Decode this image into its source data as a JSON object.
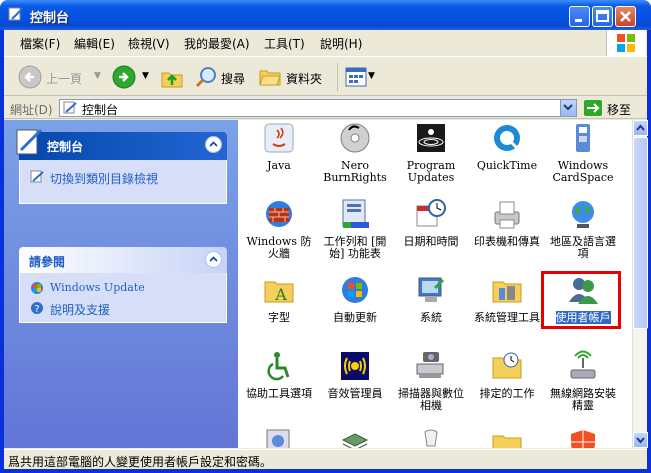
{
  "window": {
    "title": "控制台"
  },
  "menu": [
    "檔案(F)",
    "編輯(E)",
    "檢視(V)",
    "我的最愛(A)",
    "工具(T)",
    "說明(H)"
  ],
  "toolbar": {
    "back": "上一頁",
    "search": "搜尋",
    "folders": "資料夾"
  },
  "address": {
    "label": "網址(D)",
    "value": "控制台",
    "go": "移至"
  },
  "sidebar": {
    "panel1": {
      "title": "控制台",
      "link": "切換到類別目錄檢視"
    },
    "panel2": {
      "title": "請參閱",
      "links": [
        "Windows Update",
        "說明及支援"
      ]
    }
  },
  "items": [
    "Java",
    "Nero BurnRights",
    "Program Updates",
    "QuickTime",
    "Windows CardSpace",
    "Windows 防火牆",
    "工作列和 [開始] 功能表",
    "日期和時間",
    "印表機和傳真",
    "地區及語言選項",
    "字型",
    "自動更新",
    "系統",
    "系統管理工具",
    "使用者帳戶",
    "協助工具選項",
    "音效管理員",
    "掃描器與數位相機",
    "排定的工作",
    "無線網路安裝精靈"
  ],
  "status": "爲共用這部電腦的人變更使用者帳戶設定和密碼。",
  "colors": {
    "highlight": "#e80000",
    "selection": "#316ac5"
  }
}
